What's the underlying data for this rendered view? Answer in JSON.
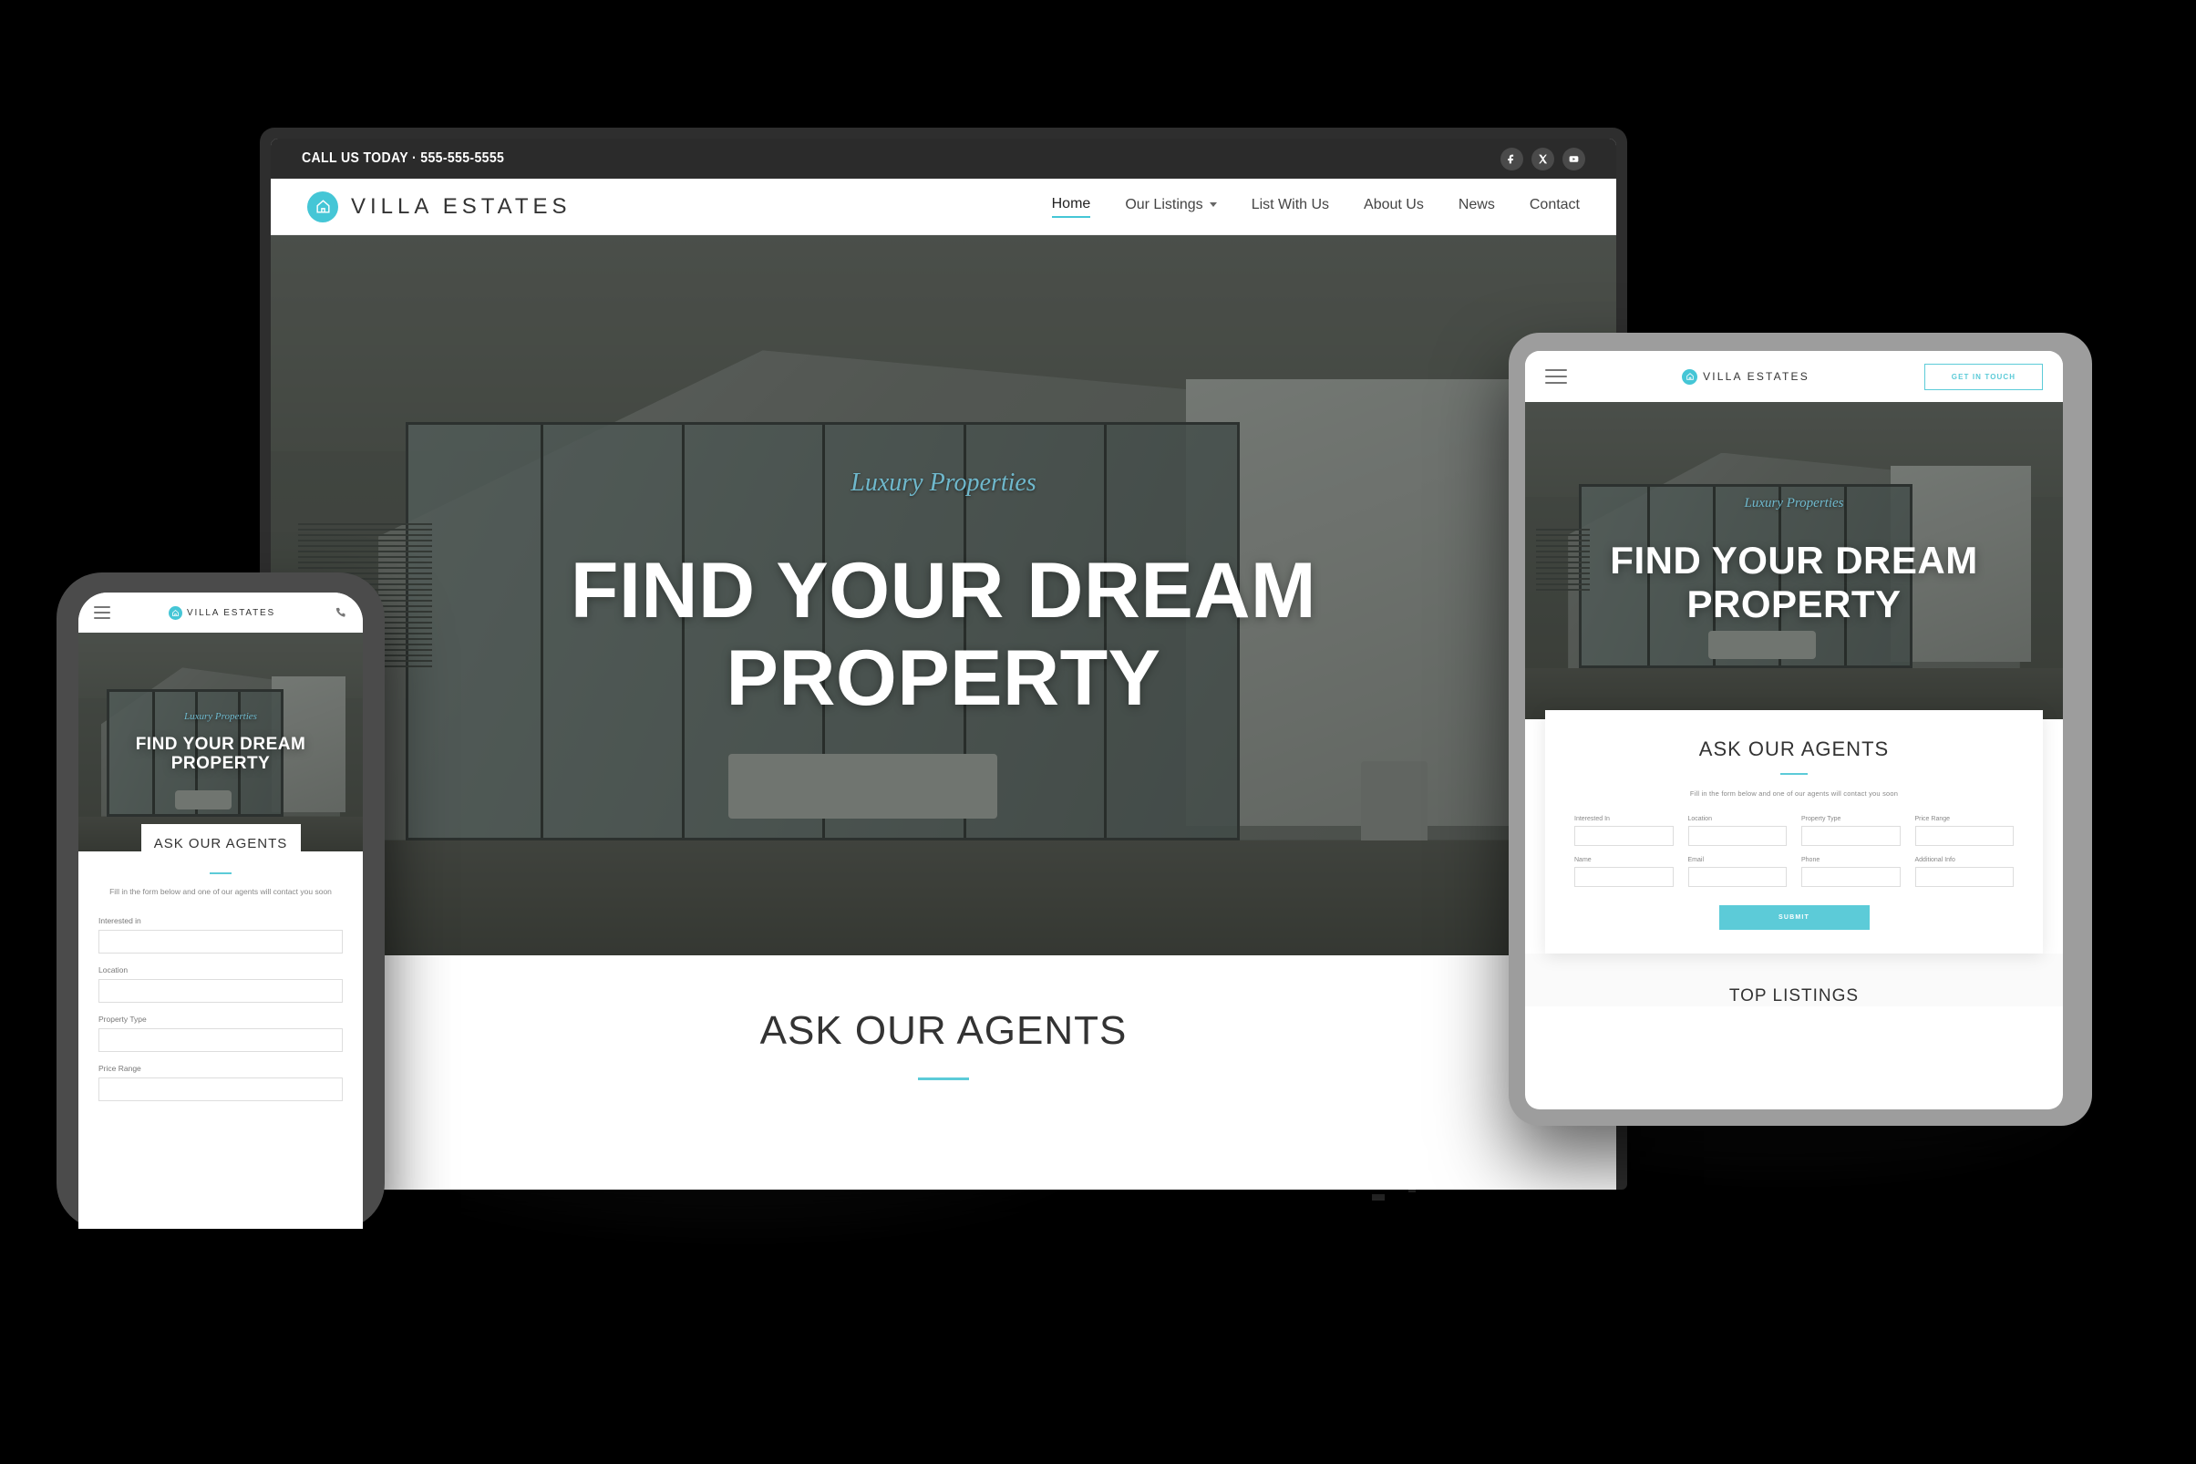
{
  "brand": {
    "name": "VILLA ESTATES",
    "mark_icon": "house-icon",
    "accent": "#5ccbd8"
  },
  "desktop": {
    "topbar": {
      "phone_text": "CALL US TODAY · 555-555-5555",
      "socials": [
        {
          "name": "facebook-icon",
          "glyph": "f"
        },
        {
          "name": "x-twitter-icon",
          "glyph": "X"
        },
        {
          "name": "youtube-icon",
          "glyph": "▶"
        }
      ]
    },
    "nav": [
      {
        "label": "Home",
        "active": true,
        "has_dropdown": false
      },
      {
        "label": "Our Listings",
        "active": false,
        "has_dropdown": true
      },
      {
        "label": "List With Us",
        "active": false,
        "has_dropdown": false
      },
      {
        "label": "About Us",
        "active": false,
        "has_dropdown": false
      },
      {
        "label": "News",
        "active": false,
        "has_dropdown": false
      },
      {
        "label": "Contact",
        "active": false,
        "has_dropdown": false
      }
    ],
    "hero": {
      "eyebrow": "Luxury Properties",
      "title": "FIND YOUR DREAM PROPERTY"
    },
    "section": {
      "title": "ASK OUR AGENTS"
    }
  },
  "tablet": {
    "nav": {
      "menu_icon": "hamburger-menu-icon",
      "cta_label": "GET IN TOUCH"
    },
    "hero": {
      "eyebrow": "Luxury Properties",
      "title": "FIND YOUR DREAM PROPERTY"
    },
    "form": {
      "title": "ASK OUR AGENTS",
      "subtitle": "Fill in the form below and one of our agents will contact you soon",
      "fields": [
        {
          "label": "Interested In",
          "value": ""
        },
        {
          "label": "Location",
          "value": ""
        },
        {
          "label": "Property Type",
          "value": ""
        },
        {
          "label": "Price Range",
          "value": ""
        },
        {
          "label": "Name",
          "value": ""
        },
        {
          "label": "Email",
          "value": ""
        },
        {
          "label": "Phone",
          "value": ""
        },
        {
          "label": "Additional Info",
          "value": ""
        }
      ],
      "submit_label": "SUBMIT"
    },
    "next_section": {
      "title": "TOP LISTINGS"
    }
  },
  "mobile": {
    "nav": {
      "menu_icon": "hamburger-menu-icon",
      "phone_icon": "phone-icon"
    },
    "hero": {
      "eyebrow": "Luxury Properties",
      "title": "FIND YOUR DREAM PROPERTY"
    },
    "form": {
      "title": "ASK OUR AGENTS",
      "subtitle": "Fill in the form below and one of our agents will contact you soon",
      "fields": [
        {
          "label": "Interested in",
          "value": ""
        },
        {
          "label": "Location",
          "value": ""
        },
        {
          "label": "Property Type",
          "value": ""
        },
        {
          "label": "Price Range",
          "value": ""
        }
      ]
    }
  }
}
